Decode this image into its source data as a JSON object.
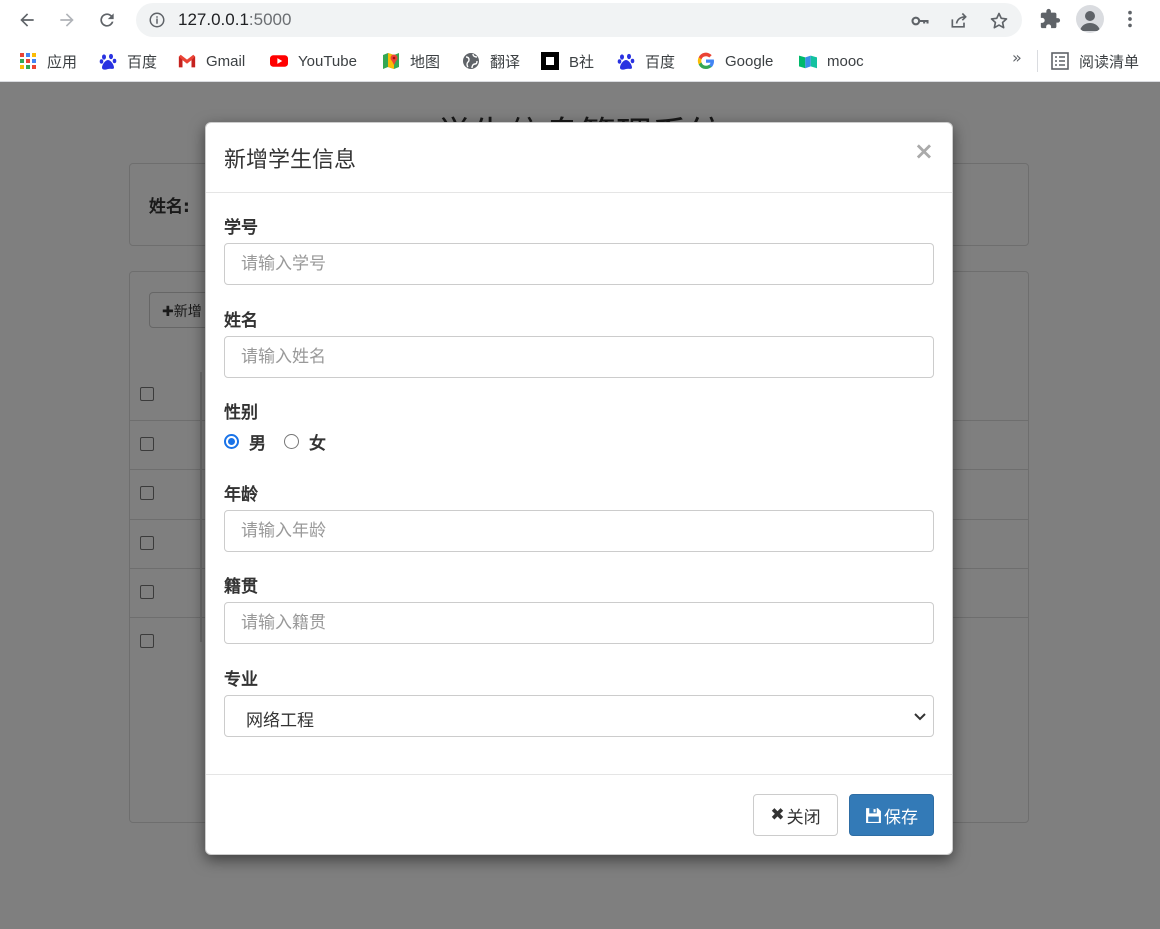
{
  "browser": {
    "url_host": "127.0.0.1",
    "url_port": ":5000",
    "bookmarks": [
      {
        "label": "应用",
        "icon": "apps-grid-icon"
      },
      {
        "label": "百度",
        "icon": "baidu-paw-icon"
      },
      {
        "label": "Gmail",
        "icon": "gmail-icon"
      },
      {
        "label": "YouTube",
        "icon": "youtube-icon"
      },
      {
        "label": "地图",
        "icon": "maps-icon"
      },
      {
        "label": "翻译",
        "icon": "globe-icon"
      },
      {
        "label": "B社",
        "icon": "square-logo-icon"
      },
      {
        "label": "百度",
        "icon": "baidu-paw-icon"
      },
      {
        "label": "Google",
        "icon": "google-g-icon"
      },
      {
        "label": "mooc",
        "icon": "mooc-icon"
      }
    ],
    "more_label": "»",
    "reading_list_label": "阅读清单"
  },
  "page": {
    "title": "学生信息管理系统",
    "search_label": "姓名:",
    "add_label": "新增"
  },
  "modal": {
    "title": "新增学生信息",
    "close_symbol": "×",
    "fields": {
      "id_label": "学号",
      "id_placeholder": "请输入学号",
      "name_label": "姓名",
      "name_placeholder": "请输入姓名",
      "gender_label": "性别",
      "gender_male": "男",
      "gender_female": "女",
      "gender_selected": "男",
      "age_label": "年龄",
      "age_placeholder": "请输入年龄",
      "origin_label": "籍贯",
      "origin_placeholder": "请输入籍贯",
      "major_label": "专业",
      "major_value": "网络工程"
    },
    "close_button": "关闭",
    "save_button": "保存"
  },
  "colors": {
    "primary": "#337ab7",
    "radio_accent": "#1a73e8",
    "youtube_red": "#ff0000"
  }
}
